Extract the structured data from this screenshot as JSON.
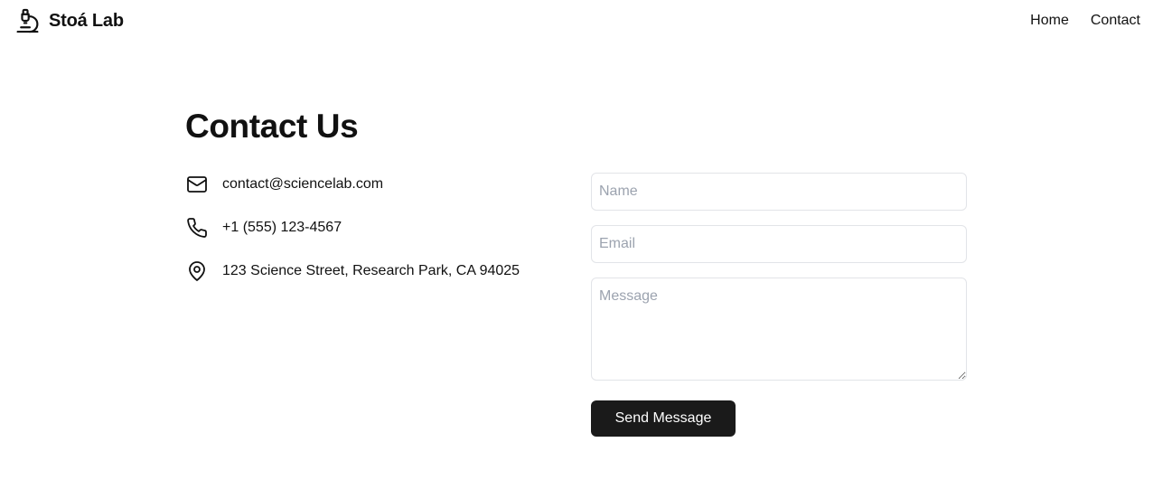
{
  "header": {
    "brand_icon": "microscope-icon",
    "brand_name": "Stoá Lab",
    "nav": [
      {
        "label": "Home"
      },
      {
        "label": "Contact"
      }
    ]
  },
  "main": {
    "title": "Contact Us",
    "contact_info": [
      {
        "icon": "mail-icon",
        "text": "contact@sciencelab.com"
      },
      {
        "icon": "phone-icon",
        "text": "+1 (555) 123-4567"
      },
      {
        "icon": "map-pin-icon",
        "text": "123 Science Street, Research Park, CA 94025"
      }
    ],
    "form": {
      "name_placeholder": "Name",
      "name_value": "",
      "email_placeholder": "Email",
      "email_value": "",
      "message_placeholder": "Message",
      "message_value": "",
      "submit_label": "Send Message"
    }
  },
  "colors": {
    "text": "#111111",
    "button_bg": "#1a1a1a",
    "button_text": "#ffffff",
    "input_border": "#e2e4e8",
    "placeholder": "#9ca3af"
  }
}
